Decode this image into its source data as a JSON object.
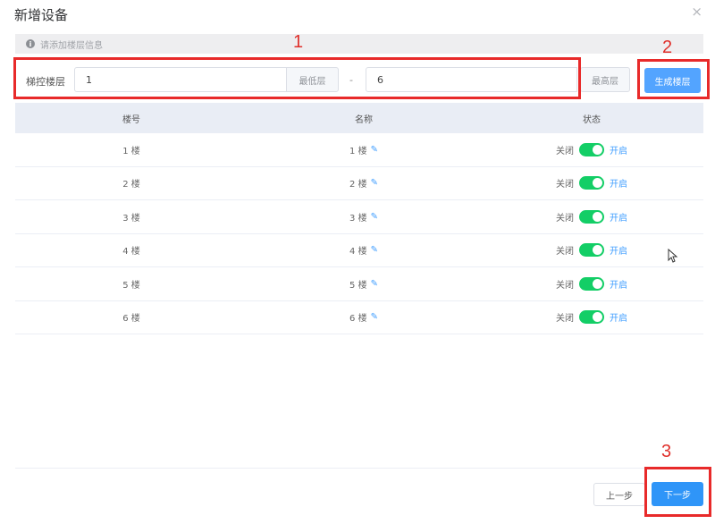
{
  "dialog": {
    "title": "新增设备",
    "close_glyph": "×"
  },
  "info": {
    "icon": "info-icon",
    "text": "请添加楼层信息"
  },
  "floor_range": {
    "label": "梯控楼层",
    "min_value": "1",
    "min_addon": "最低层",
    "separator": "-",
    "max_value": "6",
    "max_addon": "最高层",
    "generate_label": "生成楼层"
  },
  "table": {
    "headers": [
      "楼号",
      "名称",
      "状态"
    ],
    "rows": [
      {
        "floor": "1 楼",
        "name": "1 楼",
        "off": "关闭",
        "on": "开启",
        "enabled": true
      },
      {
        "floor": "2 楼",
        "name": "2 楼",
        "off": "关闭",
        "on": "开启",
        "enabled": true
      },
      {
        "floor": "3 楼",
        "name": "3 楼",
        "off": "关闭",
        "on": "开启",
        "enabled": true
      },
      {
        "floor": "4 楼",
        "name": "4 楼",
        "off": "关闭",
        "on": "开启",
        "enabled": true
      },
      {
        "floor": "5 楼",
        "name": "5 楼",
        "off": "关闭",
        "on": "开启",
        "enabled": true
      },
      {
        "floor": "6 楼",
        "name": "6 楼",
        "off": "关闭",
        "on": "开启",
        "enabled": true
      }
    ]
  },
  "footer": {
    "prev_label": "上一步",
    "next_label": "下一步"
  },
  "annotations": [
    "1",
    "2",
    "3"
  ],
  "colors": {
    "annotation_red": "#e82a2a",
    "primary_blue": "#2f95f8",
    "switch_green": "#13ce66"
  }
}
